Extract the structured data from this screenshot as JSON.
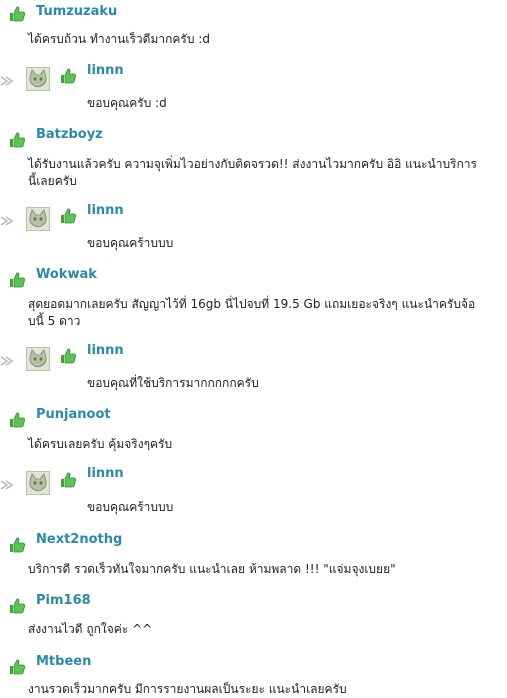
{
  "comments": [
    {
      "author": "Tumzuzaku",
      "text": "ได้ครบถ้วน ทำงานเร็วดีมากครับ :d",
      "reply": {
        "author": "linnn",
        "text": "ขอบคุณครับ :d"
      }
    },
    {
      "author": "Batzboyz",
      "text": "ได้รับงานแล้วครับ ความจุเพิ่มไวอย่างกับติดจรวด!! ส่งงานไวมากครับ อิอิ แนะนำบริการนี้เลยครับ",
      "reply": {
        "author": "linnn",
        "text": "ขอบคุณคร้าบบบ"
      }
    },
    {
      "author": "Wokwak",
      "text": "สุดยอดมากเลยครับ สัญญาไว้ที่ 16gb นี่ไปจบที่ 19.5 Gb แถมเยอะจริงๆ แนะนำครับจ้อบนี้ 5 ดาว",
      "reply": {
        "author": "linnn",
        "text": "ขอบคุณที่ใช้บริการมากกกกกครับ"
      }
    },
    {
      "author": "Punjanoot",
      "text": "ได้ครบเลยครับ คุ้มจริงๆครับ",
      "reply": {
        "author": "linnn",
        "text": "ขอบคุณคร้าบบบ"
      }
    },
    {
      "author": "Next2nothg",
      "text": "บริการดี รวดเร็วทันใจมากครับ แนะนำเลย ห้ามพลาด !!! \"แจ่มจุงเบยย\""
    },
    {
      "author": "Pim168",
      "text": "ส่งงานไวดี ถูกใจค่ะ ^^"
    },
    {
      "author": "Mtbeen",
      "text": "งานรวดเร็วมากครับ มีการรายงานผลเป็นระยะ แนะนำเลยครับ"
    }
  ],
  "colors": {
    "username": "#2a8aa8",
    "thumb": "#4cb848"
  },
  "icons": {
    "rating": "thumbs-up-icon",
    "reply": "reply-arrow-icon",
    "avatar": "cat-avatar"
  }
}
